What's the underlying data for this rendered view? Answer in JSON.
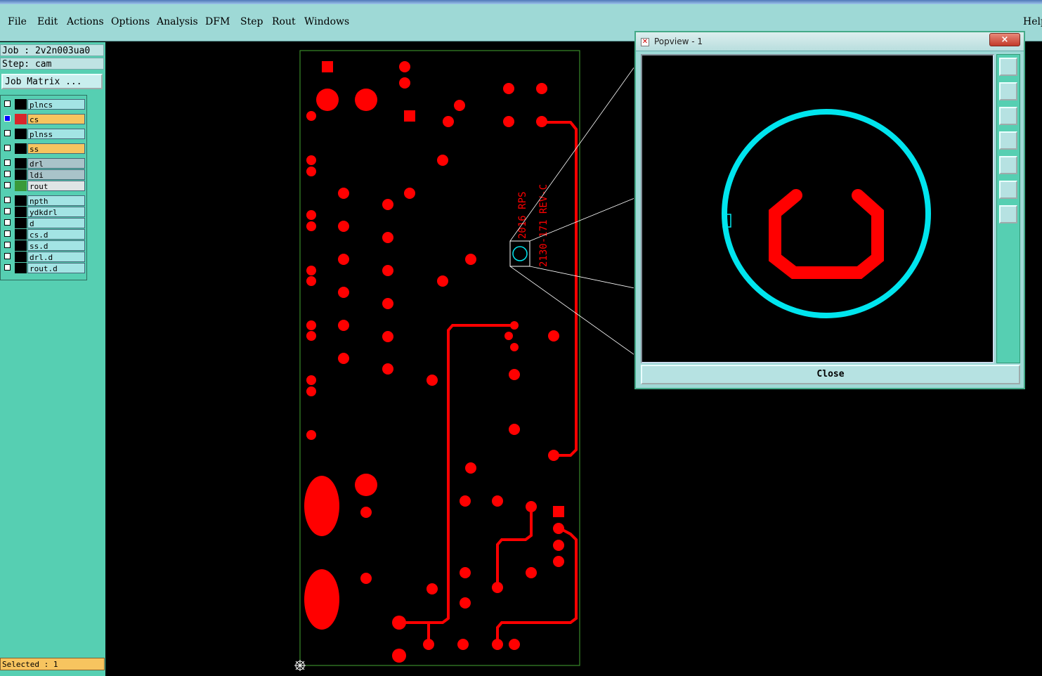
{
  "menu": {
    "file": "File",
    "edit": "Edit",
    "actions": "Actions",
    "options": "Options",
    "analysis": "Analysis",
    "dfm": "DFM",
    "step": "Step",
    "rout": "Rout",
    "windows": "Windows",
    "help": "Help"
  },
  "job": {
    "job_line": "Job : 2v2n003ua0",
    "step_line": "Step: cam",
    "matrix_button": "Job Matrix ..."
  },
  "layers": [
    {
      "name": "plncs",
      "color": "#a3e4e4"
    },
    {
      "name": "cs",
      "color": "#f7c45f",
      "active": true
    },
    {
      "name": "plnss",
      "color": "#a3e4e4"
    },
    {
      "name": "ss",
      "color": "#f7c45f"
    },
    {
      "name": "drl",
      "color": "#a9c3c9"
    },
    {
      "name": "ldi",
      "color": "#a9c3c9"
    },
    {
      "name": "rout",
      "color": "#dfe5e5",
      "cell": "#3a9a3a"
    },
    {
      "name": "npth",
      "color": "#a3e4e4"
    },
    {
      "name": "ydkdrl",
      "color": "#a3e4e4"
    },
    {
      "name": "d",
      "color": "#a3e4e4"
    },
    {
      "name": "cs.d",
      "color": "#a3e4e4"
    },
    {
      "name": "ss.d",
      "color": "#a3e4e4"
    },
    {
      "name": "drl.d",
      "color": "#a3e4e4"
    },
    {
      "name": "rout.d",
      "color": "#a3e4e4"
    }
  ],
  "status": {
    "selected": "Selected : 1"
  },
  "board": {
    "silk_text_1": "2016 RPS",
    "silk_text_2": "2130-171 REV-C",
    "copper_color": "#ff0000",
    "outline_color": "#3a8a2a",
    "highlight_color": "#00e5ee"
  },
  "popview": {
    "title": "Popview - 1",
    "close_x": "×",
    "close_button": "Close"
  },
  "colors": {
    "menubar": "#9ed9d6",
    "panel": "#56cfb2",
    "status": "#f7c45f"
  }
}
